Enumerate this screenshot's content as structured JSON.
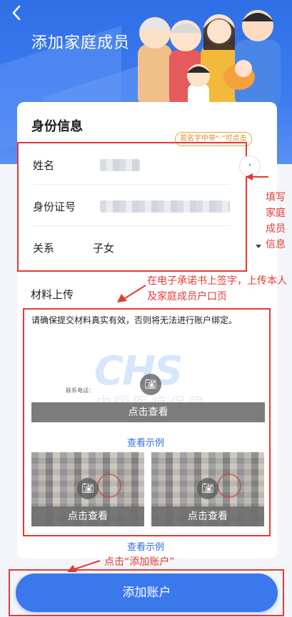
{
  "header": {
    "title": "添加家庭成员",
    "back_icon": "chevron-left-icon"
  },
  "identity": {
    "section_title": "身份信息",
    "hint_tag": "若名字中带“·”可点击",
    "dot_button": "·",
    "fields": [
      {
        "label": "姓名",
        "value": ""
      },
      {
        "label": "身份证号",
        "value": ""
      },
      {
        "label": "关系",
        "value": "子女"
      }
    ]
  },
  "annotations": {
    "side": "填写家庭成员信息",
    "materials": "在电子承诺书上签字，上传本人及家庭成员户口页",
    "add": "点击“添加账户”"
  },
  "materials": {
    "label": "材料上传",
    "description": "请确保提交材料真实有效，否则将无法进行账户绑定。",
    "doc_contact": "联系电话：",
    "watermark": "CHS",
    "watermark_sub": "中国医疗保障",
    "view_label": "点击查看",
    "example_label": "查看示例",
    "thumbs": [
      {
        "view_label": "点击查看"
      },
      {
        "view_label": "点击查看"
      }
    ]
  },
  "footer": {
    "example_label": "查看示例",
    "add_button": "添加账户"
  },
  "colors": {
    "primary": "#3b78ec",
    "annotation": "#e53935",
    "hint": "#e8891f"
  }
}
